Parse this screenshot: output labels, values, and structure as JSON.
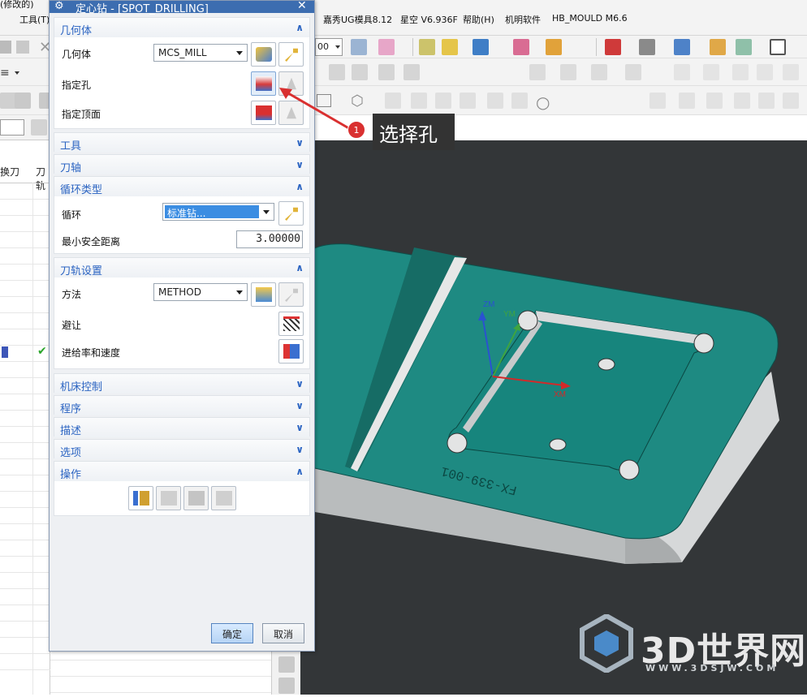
{
  "menubar": {
    "left_fragment": "(修改的)",
    "tools_menu": "工具(T)",
    "items": [
      "嘉秀UG模具8.12",
      "星空 V6.936F",
      "帮助(H)",
      "机明软件",
      "HB_MOULD M6.6"
    ]
  },
  "toolbar": {
    "zoom_value": "00"
  },
  "navigator": {
    "col_headers": [
      "换刀",
      "刀轨"
    ]
  },
  "dialog": {
    "title": "定心钻 - [SPOT_DRILLING]",
    "close_glyph": "✕",
    "geometry_section": {
      "header": "几何体",
      "geometry_label": "几何体",
      "geometry_value": "MCS_MILL",
      "specify_holes_label": "指定孔",
      "specify_top_label": "指定顶面"
    },
    "tool_section": {
      "header": "工具"
    },
    "axis_section": {
      "header": "刀轴"
    },
    "cycle_section": {
      "header": "循环类型",
      "cycle_label": "循环",
      "cycle_value": "标准钻...",
      "min_clearance_label": "最小安全距离",
      "min_clearance_value": "3.00000"
    },
    "path_section": {
      "header": "刀轨设置",
      "method_label": "方法",
      "method_value": "METHOD",
      "avoid_label": "避让",
      "feeds_label": "进给率和速度"
    },
    "machine_section": {
      "header": "机床控制"
    },
    "program_section": {
      "header": "程序"
    },
    "desc_section": {
      "header": "描述"
    },
    "options_section": {
      "header": "选项"
    },
    "actions_section": {
      "header": "操作"
    },
    "ok_label": "确定",
    "cancel_label": "取消"
  },
  "callout": {
    "number": "1",
    "text": "选择孔"
  },
  "viewport": {
    "axis_zm": "ZM",
    "axis_ym": "YM",
    "axis_xm": "XM",
    "engraving": "FX-339-001"
  },
  "watermark": {
    "title": "3D世界网",
    "url": "WWW.3DSJW.COM"
  },
  "colors": {
    "part_top": "#1e8a82",
    "viewport_bg": "#333638",
    "accent": "#2b64c2"
  }
}
